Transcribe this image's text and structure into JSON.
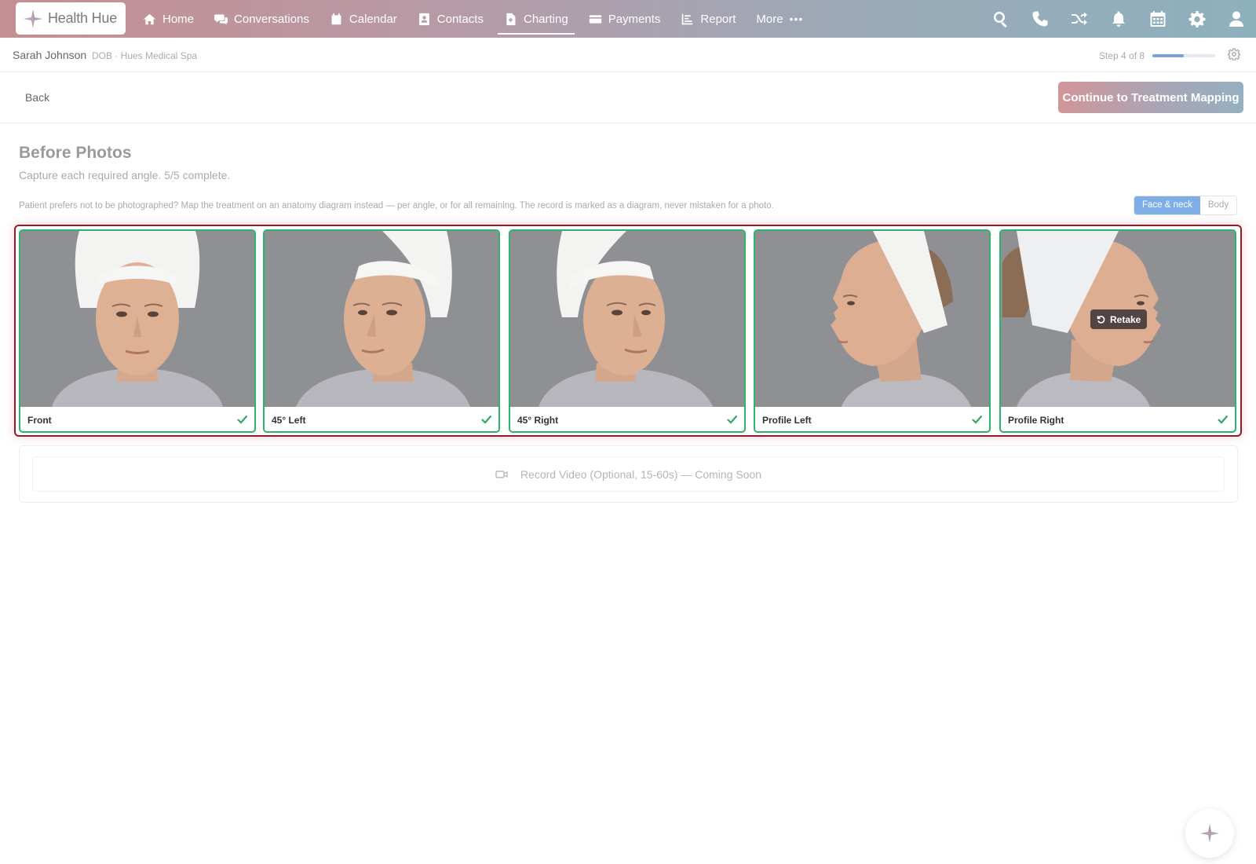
{
  "app": {
    "name": "Health Hue"
  },
  "nav": {
    "items": [
      {
        "label": "Home",
        "icon": "home-icon"
      },
      {
        "label": "Conversations",
        "icon": "chat-icon"
      },
      {
        "label": "Calendar",
        "icon": "calendar-icon"
      },
      {
        "label": "Contacts",
        "icon": "contact-card-icon"
      },
      {
        "label": "Charting",
        "icon": "document-plus-icon",
        "active": true
      },
      {
        "label": "Payments",
        "icon": "credit-card-icon"
      },
      {
        "label": "Report",
        "icon": "chart-icon"
      },
      {
        "label": "More",
        "icon": "ellipsis-icon"
      }
    ],
    "more_dots": "•••",
    "right_icons": [
      "search-icon",
      "phone-icon",
      "shuffle-icon",
      "bell-icon",
      "calendar-icon",
      "gear-icon",
      "user-icon"
    ]
  },
  "patient": {
    "name": "Sarah Johnson",
    "meta": "DOB · Hues Medical Spa",
    "step_label": "Step 4 of 8",
    "step_progress": 0.5
  },
  "actions": {
    "back_label": "Back",
    "continue_label": "Continue to Treatment Mapping"
  },
  "page": {
    "title": "Before Photos",
    "subtitle": "Capture each required angle. 5/5 complete.",
    "notice": "Patient prefers not to be photographed? Map the treatment on an anatomy diagram instead — per angle, or for all remaining. The record is marked as a diagram, never mistaken for a photo.",
    "toggle": {
      "options": [
        "Face & neck",
        "Body"
      ],
      "selected": "Face & neck"
    }
  },
  "photos": [
    {
      "label": "Front",
      "status": "complete"
    },
    {
      "label": "45° Left",
      "status": "complete"
    },
    {
      "label": "45° Right",
      "status": "complete"
    },
    {
      "label": "Profile Left",
      "status": "complete"
    },
    {
      "label": "Profile Right",
      "status": "complete",
      "overlay": "Retake"
    }
  ],
  "video": {
    "label": "Record Video (Optional, 15-60s) — Coming Soon"
  },
  "colors": {
    "accent_blue": "#7faee6",
    "complete_green": "#2fb36b",
    "selection_border": "#8a1f2b",
    "nav_gradient_start": "#c58f93",
    "nav_gradient_end": "#8eb0bd"
  }
}
